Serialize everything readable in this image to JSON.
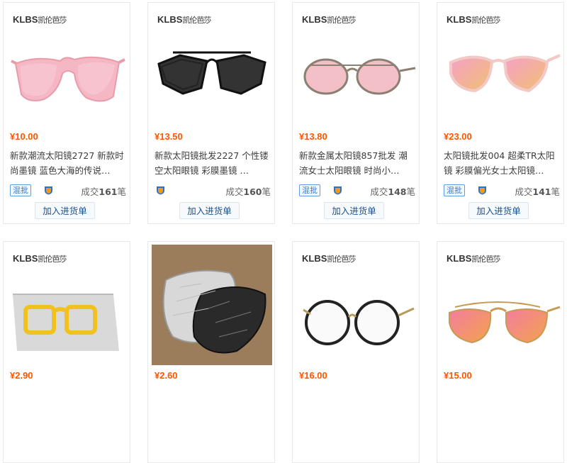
{
  "brand": {
    "latin": "KLBS",
    "cn": "凯伦芭莎"
  },
  "cart_label": "加入进货单",
  "mix_label": "混批",
  "deal_prefix": "成交",
  "deal_suffix": "笔",
  "products": [
    {
      "price": "¥10.00",
      "title": "新款潮流太阳镜2727 新款时尚墨镜 蓝色大海的传说…",
      "mix": true,
      "deals": "161"
    },
    {
      "price": "¥13.50",
      "title": "新款太阳镜批发2227 个性镂空太阳眼镜 彩膜墨镜 …",
      "mix": false,
      "deals": "160"
    },
    {
      "price": "¥13.80",
      "title": "新款金属太阳镜857批发 潮流女士太阳眼镜 时尚小…",
      "mix": true,
      "deals": "148"
    },
    {
      "price": "¥23.00",
      "title": "太阳镜批发004 超柔TR太阳镜 彩膜偏光女士太阳镜…",
      "mix": true,
      "deals": "141"
    },
    {
      "price": "¥2.90"
    },
    {
      "price": "¥2.60"
    },
    {
      "price": "¥16.00"
    },
    {
      "price": "¥15.00"
    }
  ],
  "colors": {
    "price": "#ff5500",
    "link": "#1d4f88",
    "mix_border": "#5d9de0"
  }
}
